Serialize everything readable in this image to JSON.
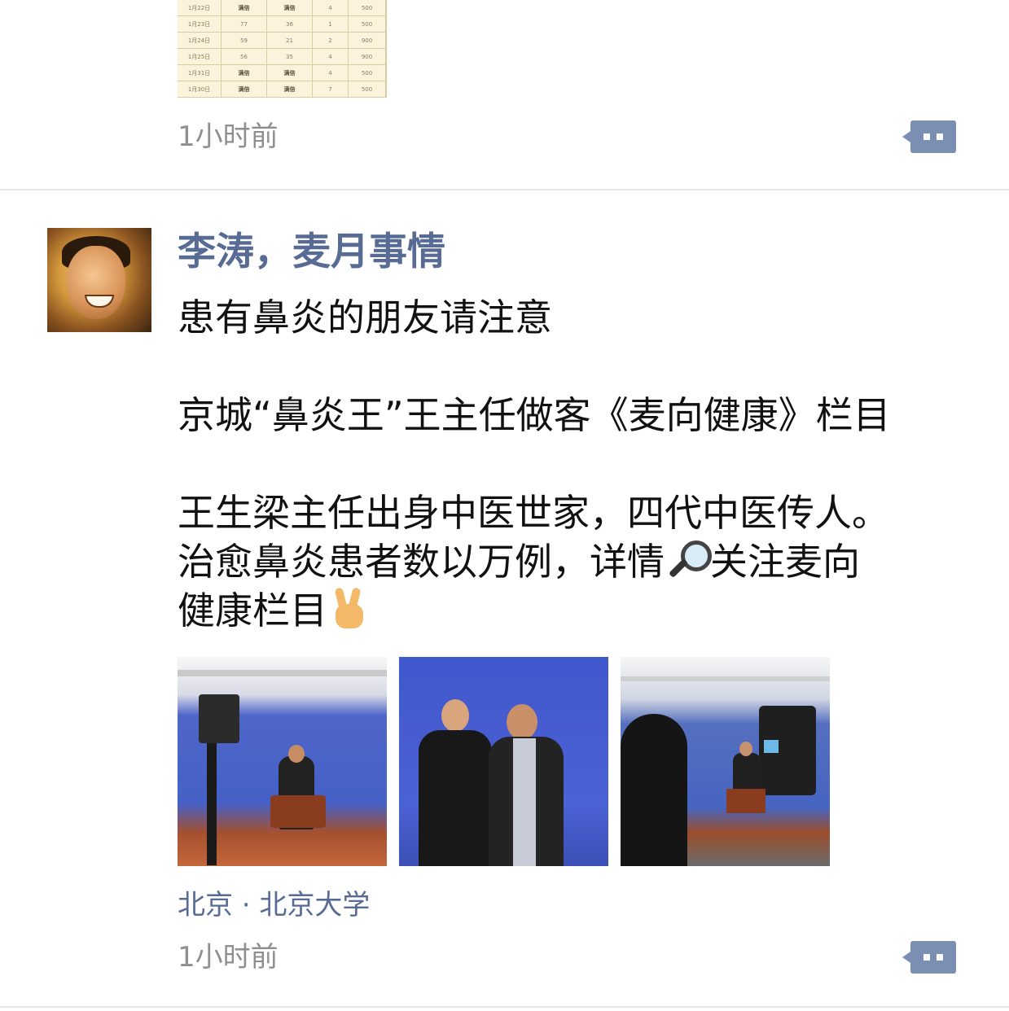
{
  "previous_post": {
    "time": "1小时前",
    "table_rows": [
      [
        "1月22日",
        "满倍",
        "满倍",
        "4",
        "500"
      ],
      [
        "1月23日",
        "77",
        "36",
        "1",
        "500"
      ],
      [
        "1月24日",
        "59",
        "21",
        "2",
        "900"
      ],
      [
        "1月25日",
        "56",
        "35",
        "4",
        "900"
      ],
      [
        "1月31日",
        "满倍",
        "满倍",
        "4",
        "500"
      ],
      [
        "1月30日",
        "满倍",
        "满倍",
        "7",
        "500"
      ]
    ]
  },
  "post": {
    "author": "李涛，麦月事情",
    "lines": [
      "患有鼻炎的朋友请注意",
      "京城“鼻炎王”王主任做客《麦向健康》栏目",
      "王生梁主任出身中医世家，四代中医传人。",
      "治愈鼻炎患者数以万例，详情",
      "关注麦向",
      "健康栏目"
    ],
    "location": "北京 · 北京大学",
    "time": "1小时前"
  },
  "icons": {
    "comment": "comment-icon",
    "magnifier": "magnifier-emoji",
    "peace": "victory-hand-emoji"
  },
  "colors": {
    "link": "#576b95",
    "comment_button": "#7b8fb3",
    "time_text": "#8f8f8f"
  }
}
